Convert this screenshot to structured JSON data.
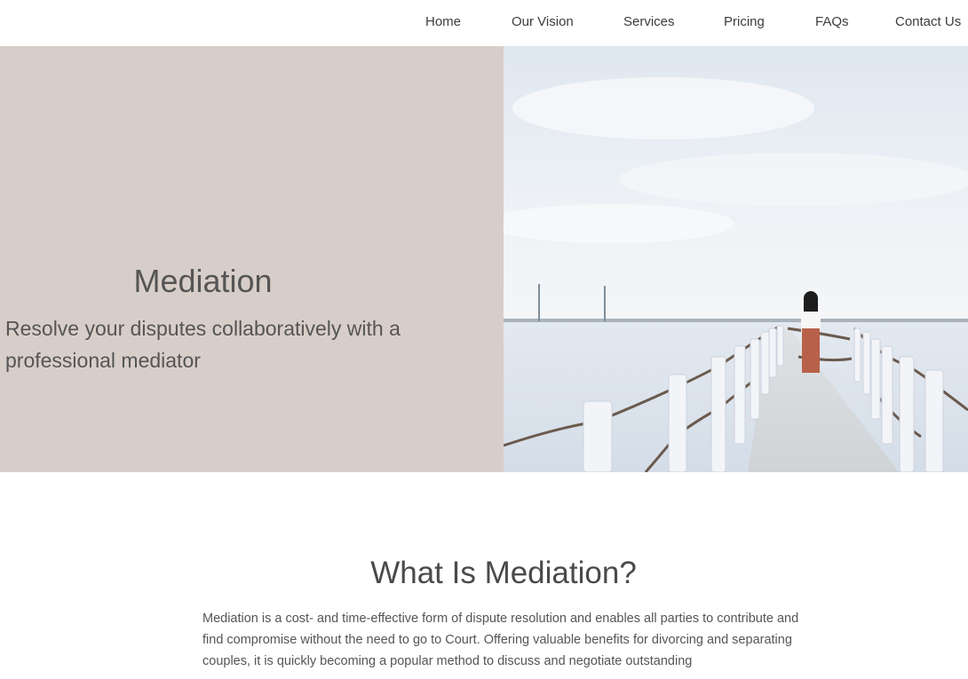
{
  "nav": {
    "items": [
      {
        "label": "Home"
      },
      {
        "label": "Our Vision"
      },
      {
        "label": "Services"
      },
      {
        "label": "Pricing"
      },
      {
        "label": "FAQs"
      },
      {
        "label": "Contact Us"
      }
    ]
  },
  "hero": {
    "title": "Mediation",
    "subtitle": "Resolve your disputes collaboratively with a professional mediator",
    "image": {
      "icon": "pier-photo",
      "colors": {
        "sky": "#e6edf3",
        "sea": "#dfe6ee",
        "pier": "#e2e4e6",
        "rail": "#f3f4f7"
      }
    }
  },
  "section": {
    "title": "What Is Mediation?",
    "body": "Mediation is a cost- and time-effective form of dispute resolution and  enables all parties to contribute and find compromise without the need  to go to Court. Offering valuable benefits for divorcing and separating  couples, it is quickly becoming a popular method to discuss and negotiate  outstanding"
  },
  "colors": {
    "hero_panel": "#d8cec9",
    "text": "#4a4a4a",
    "nav_text": "#3d3d3d"
  }
}
